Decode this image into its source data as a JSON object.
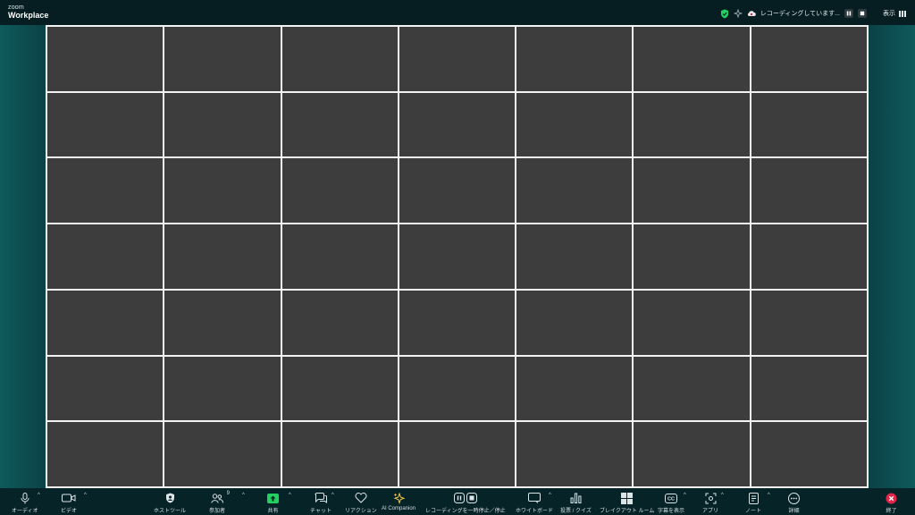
{
  "brand": {
    "line1": "zoom",
    "line2": "Workplace"
  },
  "top_right": {
    "recording_text": "レコーディングしています...",
    "view_label": "表示"
  },
  "grid": {
    "rows": 7,
    "cols": 7
  },
  "toolbar": {
    "audio": "オーディオ",
    "video": "ビデオ",
    "host_tools": "ホストツール",
    "participants": "参加者",
    "participants_count": "9",
    "share": "共有",
    "chat": "チャット",
    "reactions": "リアクション",
    "ai_companion": "AI Companion",
    "recording": "レコーディングを一時停止／停止",
    "whiteboard": "ホワイトボード",
    "polls": "投票 / クイズ",
    "breakout": "ブレイクアウト ルーム",
    "captions": "字幕を表示",
    "apps": "アプリ",
    "notes": "ノート",
    "more": "詳細",
    "end": "終了"
  },
  "colors": {
    "accent_green": "#23d160",
    "end_red": "#e0254a",
    "tile": "#3d3d3d"
  }
}
